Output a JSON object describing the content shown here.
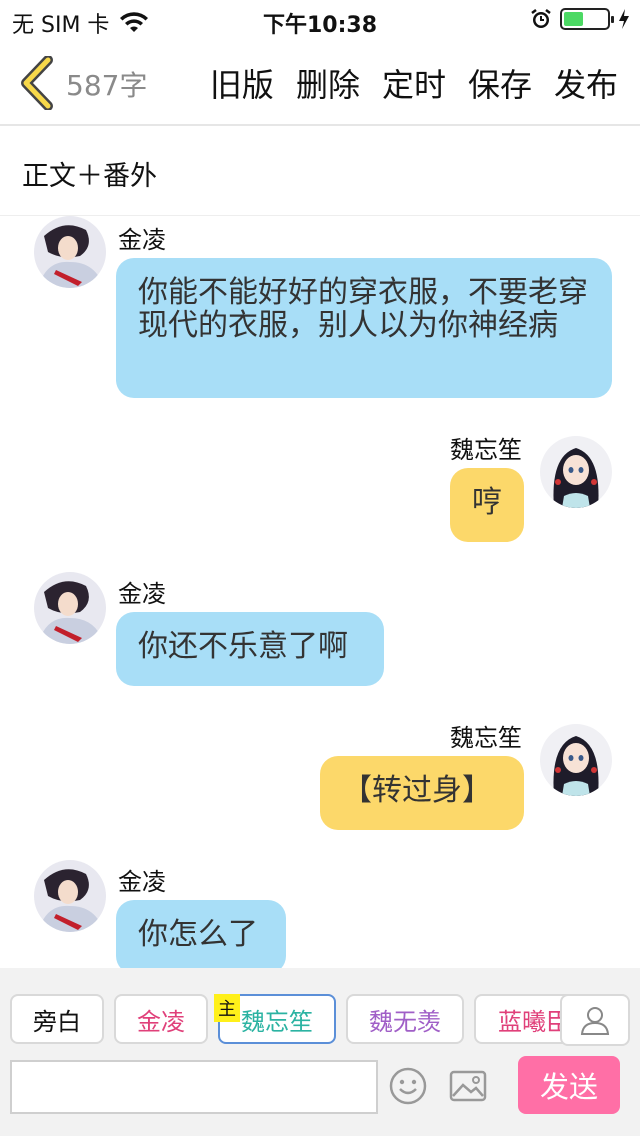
{
  "status_bar": {
    "carrier": "无 SIM 卡",
    "time": "下午10:38",
    "battery_level": 0.45
  },
  "nav": {
    "word_count": "587字",
    "actions": [
      "旧版",
      "删除",
      "定时",
      "保存",
      "发布"
    ]
  },
  "section_title": "正文＋番外",
  "messages": [
    {
      "side": "left",
      "name": "金凌",
      "text": "你能不能好好的穿衣服，不要老穿现代的衣服，别人以为你神经病"
    },
    {
      "side": "right",
      "name": "魏忘笙",
      "text": "哼"
    },
    {
      "side": "left",
      "name": "金凌",
      "text": "你还不乐意了啊"
    },
    {
      "side": "right",
      "name": "魏忘笙",
      "text": "【转过身】"
    },
    {
      "side": "left",
      "name": "金凌",
      "text": "你怎么了"
    }
  ],
  "roles": [
    {
      "label": "旁白",
      "color": "#111111"
    },
    {
      "label": "金凌",
      "color": "#e0407a"
    },
    {
      "label": "魏忘笙",
      "color": "#2bb3a2"
    },
    {
      "label": "魏无羡",
      "color": "#a05fc7"
    },
    {
      "label": "蓝曦臣",
      "color": "#e0407a"
    }
  ],
  "main_badge": "主",
  "input": {
    "value": "",
    "placeholder": ""
  },
  "send_label": "发送",
  "colors": {
    "left_bubble": "#a8def7",
    "right_bubble": "#fcd86a",
    "send": "#ff6fa6",
    "active_role_border": "#5b8fd8"
  }
}
